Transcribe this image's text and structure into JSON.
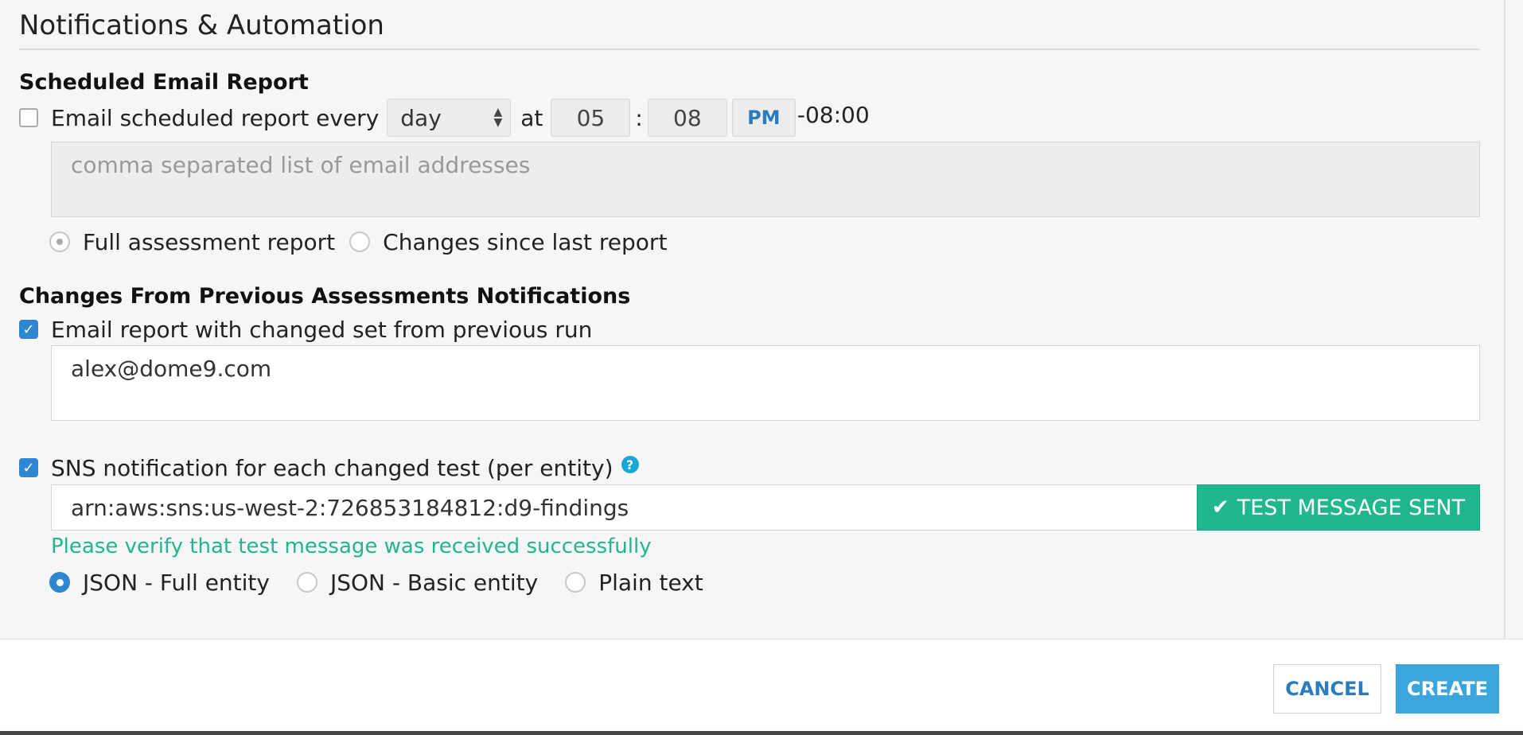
{
  "section": {
    "title": "Notifications & Automation"
  },
  "scheduled": {
    "heading": "Scheduled Email Report",
    "checkbox_label": "Email scheduled report every",
    "checked": false,
    "frequency": "day",
    "at_label": "at",
    "hour": "05",
    "colon": ":",
    "minute": "08",
    "ampm": "PM",
    "timezone": "-08:00",
    "emails_placeholder": "comma separated list of email addresses",
    "options": [
      {
        "label": "Full assessment report",
        "selected": true
      },
      {
        "label": "Changes since last report",
        "selected": false
      }
    ]
  },
  "changes": {
    "heading": "Changes From Previous Assessments Notifications",
    "email_checkbox_label": "Email report with changed set from previous run",
    "email_checked": true,
    "emails_value": "alex@dome9.com",
    "sns_checkbox_label": "SNS notification for each changed test (per entity)",
    "sns_checked": true,
    "help_glyph": "?",
    "sns_arn": "arn:aws:sns:us-west-2:726853184812:d9-findings",
    "test_button_label": "TEST MESSAGE SENT",
    "verify_message": "Please verify that test message was received successfully",
    "formats": [
      {
        "label": "JSON - Full entity",
        "selected": true
      },
      {
        "label": "JSON - Basic entity",
        "selected": false
      },
      {
        "label": "Plain text",
        "selected": false
      }
    ]
  },
  "footer": {
    "cancel_label": "CANCEL",
    "create_label": "CREATE"
  },
  "colors": {
    "accent": "#3aa6dc",
    "success": "#21b78e",
    "checkbox": "#2f86d3"
  }
}
